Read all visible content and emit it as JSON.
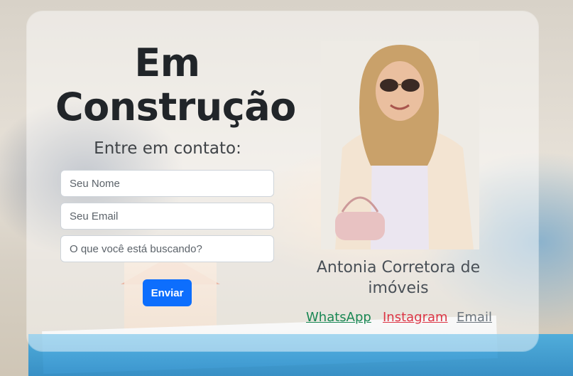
{
  "hero": {
    "title_line1": "Em",
    "title_line2": "Construção",
    "subtitle": "Entre em contato:"
  },
  "form": {
    "name_placeholder": "Seu Nome",
    "email_placeholder": "Seu Email",
    "query_placeholder": "O que você está buscando?",
    "submit_label": "Enviar"
  },
  "agent": {
    "name": "Antonia Corretora de imóveis"
  },
  "social": {
    "whatsapp_label": "WhatsApp",
    "instagram_label": "Instagram",
    "email_label": "Email"
  },
  "colors": {
    "primary": "#0d6efd",
    "whatsapp": "#198754",
    "instagram": "#dc3545",
    "email": "#6c757d",
    "title": "#212529"
  }
}
